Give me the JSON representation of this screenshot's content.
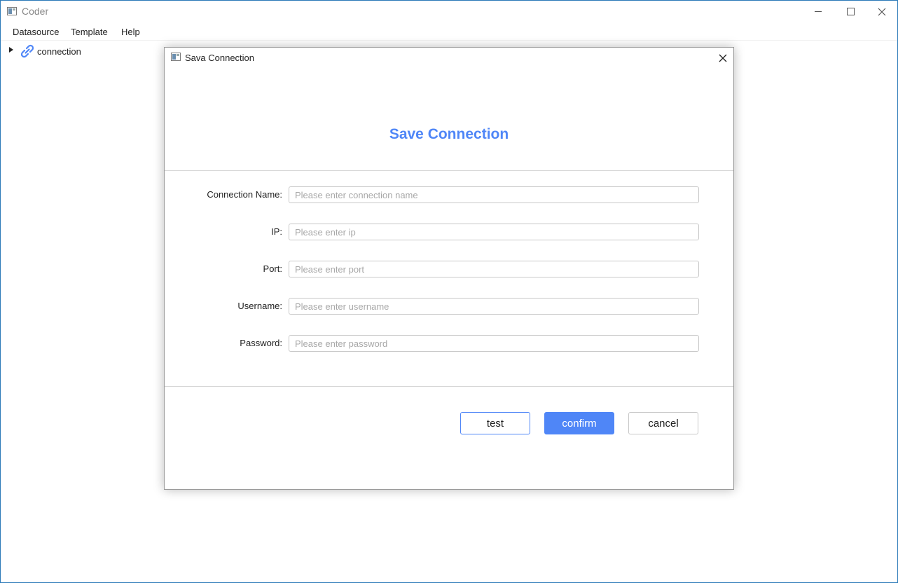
{
  "app": {
    "title": "Coder"
  },
  "menu": {
    "items": [
      "Datasource",
      "Template",
      "Help"
    ]
  },
  "tree": {
    "items": [
      {
        "label": "connection",
        "icon": "link-icon",
        "expanded": false
      }
    ]
  },
  "dialog": {
    "window_title": "Sava Connection",
    "heading": "Save Connection",
    "fields": [
      {
        "label": "Connection Name:",
        "value": "",
        "placeholder": "Please enter connection name"
      },
      {
        "label": "IP:",
        "value": "",
        "placeholder": "Please enter ip"
      },
      {
        "label": "Port:",
        "value": "",
        "placeholder": "Please enter port"
      },
      {
        "label": "Username:",
        "value": "",
        "placeholder": "Please enter username"
      },
      {
        "label": "Password:",
        "value": "",
        "placeholder": "Please enter password"
      }
    ],
    "buttons": {
      "test": "test",
      "confirm": "confirm",
      "cancel": "cancel"
    }
  },
  "colors": {
    "accent": "#4f86f7",
    "window_border": "#2b79b8"
  }
}
